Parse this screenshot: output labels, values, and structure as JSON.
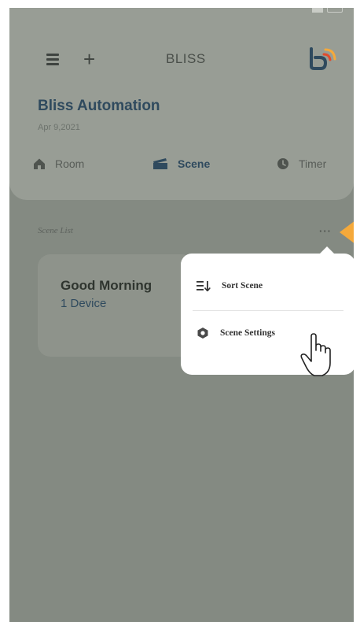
{
  "app": {
    "title": "BLISS"
  },
  "header": {
    "company": "Bliss Automation",
    "date": "Apr 9,2021"
  },
  "tabs": [
    {
      "label": "Room",
      "icon": "house-icon",
      "active": false
    },
    {
      "label": "Scene",
      "icon": "clapperboard-icon",
      "active": true
    },
    {
      "label": "Timer",
      "icon": "clock-icon",
      "active": false
    }
  ],
  "scene_list": {
    "label": "Scene List",
    "more": "···",
    "items": [
      {
        "name": "Good Morning",
        "devices": "1 Device"
      }
    ]
  },
  "popup_menu": {
    "items": [
      {
        "label": "Sort Scene",
        "icon": "sort-icon"
      },
      {
        "label": "Scene Settings",
        "icon": "hexagon-settings-icon"
      }
    ]
  },
  "colors": {
    "overlay": "#848a82",
    "brand_blue": "#2f4a5e",
    "accent_orange": "#f5a93b",
    "logo_red": "#e24a2b"
  }
}
